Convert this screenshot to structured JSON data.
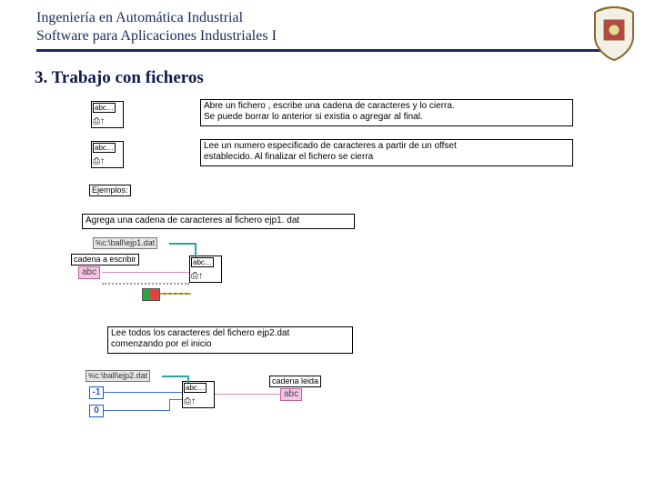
{
  "header": {
    "line1": "Ingeniería en Automática Industrial",
    "line2": "Software para Aplicaciones Industriales I"
  },
  "section_title": "3. Trabajo con ficheros",
  "rows": [
    {
      "icon_top": "abc…",
      "icon_bot": "⎙↑",
      "desc": "Abre un fichero , escribe una cadena de caracteres y lo cierra.\nSe puede borrar lo anterior si existia o agregar al final."
    },
    {
      "icon_top": "abc…",
      "icon_bot": "⎙↑",
      "desc": "Lee un numero especificado de caracteres a partir de un offset\nestablecido. Al finalizar el fichero se cierra"
    }
  ],
  "ejemplos_label": "Ejemplos:",
  "example1": {
    "caption": "Agrega una cadena de caracteres al fichero ejp1. dat",
    "path_tag": "c:\\ball\\ejp1.dat",
    "input_label": "cadena a escribir",
    "input_value": "abc",
    "icon_top": "abc…",
    "icon_bot": "⎙↑"
  },
  "example2": {
    "caption": "Lee todos los caracteres del fichero ejp2.dat\ncomenzando por el inicio",
    "path_tag": "c:\\ball\\ejp2.dat",
    "num_top": "-1",
    "num_bot": "0",
    "icon_top": "abc…",
    "icon_bot": "⎙↑",
    "out_label": "cadena leida",
    "out_value": "abc"
  }
}
